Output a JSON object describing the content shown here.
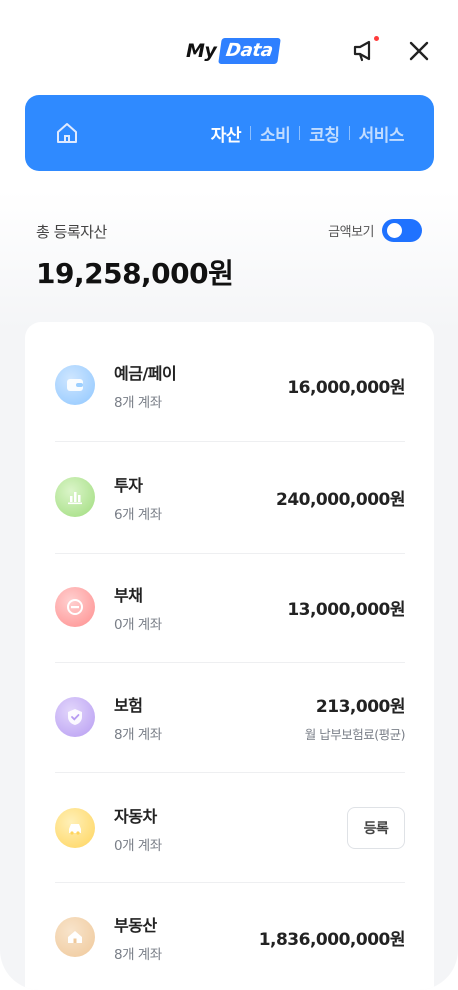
{
  "header": {
    "logo_my": "My",
    "logo_data": "Data"
  },
  "nav": {
    "tabs": [
      {
        "label": "자산"
      },
      {
        "label": "소비"
      },
      {
        "label": "코칭"
      },
      {
        "label": "서비스"
      }
    ],
    "active_index": 0,
    "accent_color": "#2f8aff"
  },
  "summary": {
    "label": "총 등록자산",
    "toggle_label": "금액보기",
    "toggle_on": true,
    "total": "19,258,000원"
  },
  "assets": [
    {
      "title": "예금/페이",
      "sub": "8개 계좌",
      "amount": "16,000,000원",
      "icon": "wallet-icon",
      "color": "#8fc7ff"
    },
    {
      "title": "투자",
      "sub": "6개 계좌",
      "amount": "240,000,000원",
      "icon": "bar-chart-icon",
      "color": "#9fdc7d"
    },
    {
      "title": "부채",
      "sub": "0개 계좌",
      "amount": "13,000,000원",
      "icon": "minus-circle-icon",
      "color": "#ff8e8e"
    },
    {
      "title": "보험",
      "sub": "8개 계좌",
      "amount": "213,000원",
      "note": "월 납부보험료(평균)",
      "icon": "shield-check-icon",
      "color": "#b79cf2"
    },
    {
      "title": "자동차",
      "sub": "0개 계좌",
      "button": "등록",
      "icon": "car-icon",
      "color": "#ffd45c"
    },
    {
      "title": "부동산",
      "sub": "8개 계좌",
      "amount": "1,836,000,000원",
      "icon": "house-icon",
      "color": "#efc89a"
    }
  ]
}
